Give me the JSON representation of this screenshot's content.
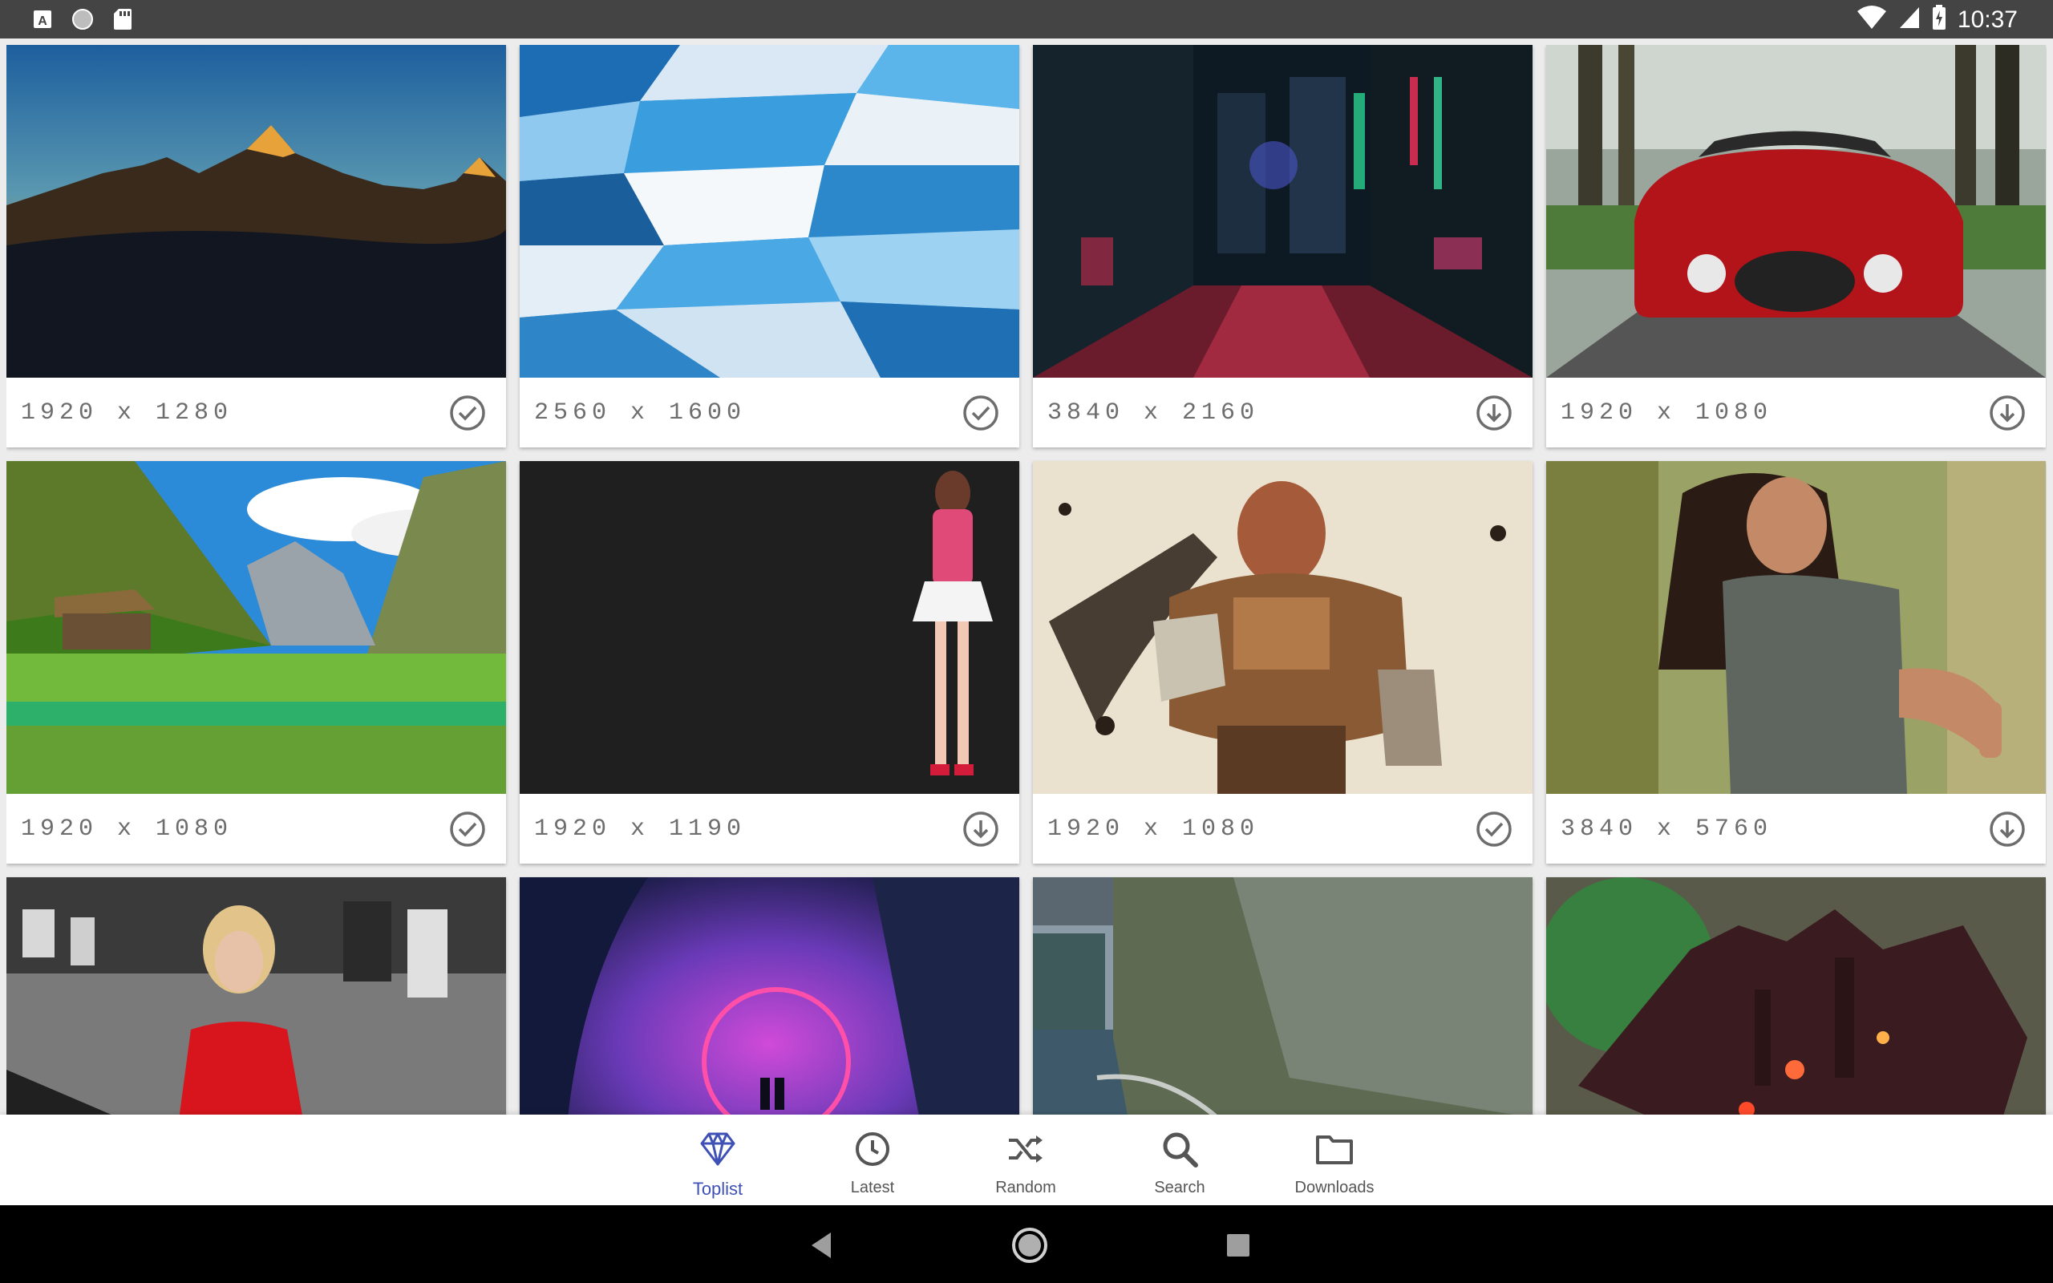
{
  "status_bar": {
    "time": "10:37",
    "left_icons": [
      "app-a-icon",
      "circle-icon",
      "sd-card-icon"
    ],
    "right_icons": [
      "wifi-icon",
      "signal-icon",
      "battery-charging-icon"
    ]
  },
  "wallpapers": [
    {
      "resolution": "1920 x 1280",
      "action": "downloaded"
    },
    {
      "resolution": "2560 x 1600",
      "action": "downloaded"
    },
    {
      "resolution": "3840 x 2160",
      "action": "download"
    },
    {
      "resolution": "1920 x 1080",
      "action": "download"
    },
    {
      "resolution": "1920 x 1080",
      "action": "downloaded"
    },
    {
      "resolution": "1920 x 1190",
      "action": "download"
    },
    {
      "resolution": "1920 x 1080",
      "action": "downloaded"
    },
    {
      "resolution": "3840 x 5760",
      "action": "download"
    },
    {
      "resolution": "",
      "action": ""
    },
    {
      "resolution": "",
      "action": ""
    },
    {
      "resolution": "",
      "action": ""
    },
    {
      "resolution": "",
      "action": ""
    }
  ],
  "bottom_nav": {
    "items": [
      {
        "label": "Toplist",
        "icon": "diamond-icon",
        "active": true
      },
      {
        "label": "Latest",
        "icon": "clock-icon",
        "active": false
      },
      {
        "label": "Random",
        "icon": "shuffle-icon",
        "active": false
      },
      {
        "label": "Search",
        "icon": "search-icon",
        "active": false
      },
      {
        "label": "Downloads",
        "icon": "folder-icon",
        "active": false
      }
    ]
  },
  "colors": {
    "accent": "#3f51b5",
    "status_bar": "#444444",
    "icon_grey": "#6d6d6d"
  }
}
